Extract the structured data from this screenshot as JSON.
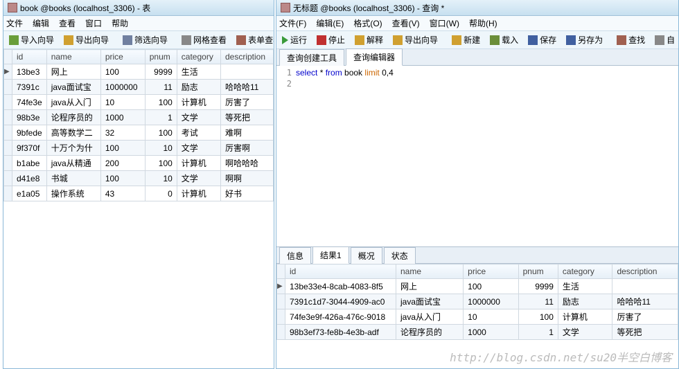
{
  "left": {
    "title": "book @books (localhost_3306) - 表",
    "menu": [
      "文件",
      "编辑",
      "查看",
      "窗口",
      "帮助"
    ],
    "toolbar": {
      "import": "导入向导",
      "export": "导出向导",
      "filter": "筛选向导",
      "gridview": "网格查看",
      "formview": "表单查看"
    },
    "cols": [
      "id",
      "name",
      "price",
      "pnum",
      "category",
      "description"
    ],
    "rows": [
      {
        "marker": "▶",
        "id": "13be3",
        "name": "网上",
        "price": "100",
        "pnum": "9999",
        "category": "生活",
        "description": ""
      },
      {
        "marker": "",
        "id": "7391c",
        "name": "java面试宝",
        "price": "1000000",
        "pnum": "11",
        "category": "励志",
        "description": "哈哈哈11"
      },
      {
        "marker": "",
        "id": "74fe3e",
        "name": "java从入门",
        "price": "10",
        "pnum": "100",
        "category": "计算机",
        "description": "厉害了"
      },
      {
        "marker": "",
        "id": "98b3e",
        "name": "论程序员的",
        "price": "1000",
        "pnum": "1",
        "category": "文学",
        "description": "等死把"
      },
      {
        "marker": "",
        "id": "9bfede",
        "name": "高等数学二",
        "price": "32",
        "pnum": "100",
        "category": "考试",
        "description": "难啊"
      },
      {
        "marker": "",
        "id": "9f370f",
        "name": "十万个为什",
        "price": "100",
        "pnum": "10",
        "category": "文学",
        "description": "厉害啊"
      },
      {
        "marker": "",
        "id": "b1abe",
        "name": "java从精通",
        "price": "200",
        "pnum": "100",
        "category": "计算机",
        "description": "啊哈哈哈"
      },
      {
        "marker": "",
        "id": "d41e8",
        "name": "书城",
        "price": "100",
        "pnum": "10",
        "category": "文学",
        "description": "啊啊"
      },
      {
        "marker": "",
        "id": "e1a05",
        "name": "操作系统",
        "price": "43",
        "pnum": "0",
        "category": "计算机",
        "description": "好书"
      }
    ]
  },
  "right": {
    "title": "无标题 @books (localhost_3306) - 查询 *",
    "menu": [
      "文件(F)",
      "编辑(E)",
      "格式(O)",
      "查看(V)",
      "窗口(W)",
      "帮助(H)"
    ],
    "toolbar": {
      "run": "运行",
      "stop": "停止",
      "explain": "解释",
      "export": "导出向导",
      "new": "新建",
      "load": "载入",
      "save": "保存",
      "saveas": "另存为",
      "find": "查找",
      "auto": "自"
    },
    "editorTabs": [
      "查询创建工具",
      "查询编辑器"
    ],
    "sql": {
      "l1_select": "select",
      "l1_star": " * ",
      "l1_from": "from",
      "l1_book": " book ",
      "l1_limit": "limit",
      "l1_args": " 0,4"
    },
    "resultTabs": [
      "信息",
      "结果1",
      "概况",
      "状态"
    ],
    "cols": [
      "id",
      "name",
      "price",
      "pnum",
      "category",
      "description"
    ],
    "rows": [
      {
        "marker": "▶",
        "id": "13be33e4-8cab-4083-8f5",
        "name": "网上",
        "price": "100",
        "pnum": "9999",
        "category": "生活",
        "description": ""
      },
      {
        "marker": "",
        "id": "7391c1d7-3044-4909-ac0",
        "name": "java面试宝",
        "price": "1000000",
        "pnum": "11",
        "category": "励志",
        "description": "哈哈哈11"
      },
      {
        "marker": "",
        "id": "74fe3e9f-426a-476c-9018",
        "name": "java从入门",
        "price": "10",
        "pnum": "100",
        "category": "计算机",
        "description": "厉害了"
      },
      {
        "marker": "",
        "id": "98b3ef73-fe8b-4e3b-adf",
        "name": "论程序员的",
        "price": "1000",
        "pnum": "1",
        "category": "文学",
        "description": "等死把"
      }
    ]
  },
  "watermark": "http://blog.csdn.net/su20半空白博客"
}
